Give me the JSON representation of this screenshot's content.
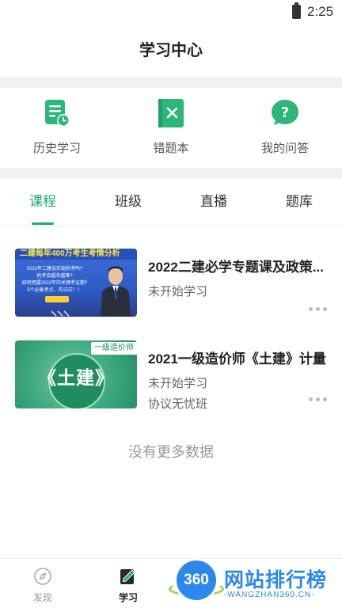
{
  "status_bar": {
    "time": "2:25"
  },
  "header": {
    "title": "学习中心"
  },
  "shortcuts": [
    {
      "label": "历史学习",
      "icon": "history-icon"
    },
    {
      "label": "错题本",
      "icon": "wrong-answers-book-icon"
    },
    {
      "label": "我的问答",
      "icon": "question-icon"
    }
  ],
  "tabs": [
    {
      "label": "课程",
      "active": true
    },
    {
      "label": "班级",
      "active": false
    },
    {
      "label": "直播",
      "active": false
    },
    {
      "label": "题库",
      "active": false
    }
  ],
  "courses": [
    {
      "title": "2022二建必学专题课及政策...",
      "status": "未开始学习",
      "thumb_band": "二建每年400万考生考情分析",
      "thumb_lines": [
        "2022年二建会实现机考吗?",
        "机考会越来越难?",
        "如何把握2022年的关键考证期?",
        "5个必备考点，先试试！！"
      ]
    },
    {
      "title": "2021一级造价师《土建》计量",
      "status": "未开始学习",
      "class_name": "协议无忧班",
      "thumb_label": "一级造价师",
      "thumb_title": "《土建》"
    }
  ],
  "footer_text": "没有更多数据",
  "bottom_nav": [
    {
      "label": "发现",
      "icon": "compass-icon",
      "active": false
    },
    {
      "label": "学习",
      "icon": "study-icon",
      "active": true
    }
  ],
  "watermark": {
    "logo_text": "360",
    "title": "网站排行榜",
    "subtitle": "-WANGZHAN360.CN-"
  },
  "colors": {
    "accent": "#1fab6a",
    "separator": "#f2f2f2",
    "text_muted": "#999999"
  }
}
